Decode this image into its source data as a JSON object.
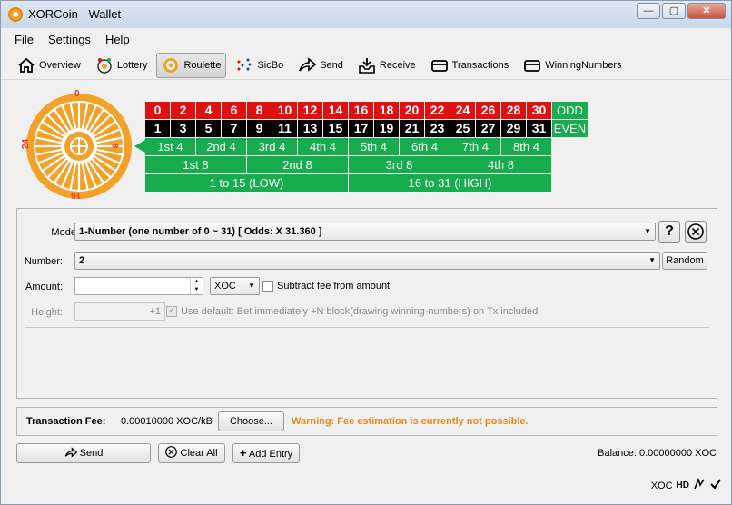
{
  "window": {
    "title": "XORCoin - Wallet",
    "minimize": "—",
    "maximize": "▢",
    "close": "✕"
  },
  "menu": {
    "file": "File",
    "settings": "Settings",
    "help": "Help"
  },
  "toolbar": {
    "overview": "Overview",
    "lottery": "Lottery",
    "roulette": "Roulette",
    "sicbo": "SicBo",
    "send": "Send",
    "receive": "Receive",
    "transactions": "Transactions",
    "winningnumbers": "WinningNumbers"
  },
  "wheel": {
    "top": "0",
    "right": "8",
    "bottom": "16",
    "left": "24"
  },
  "bet_table": {
    "even_row": [
      "0",
      "2",
      "4",
      "6",
      "8",
      "10",
      "12",
      "14",
      "16",
      "18",
      "20",
      "22",
      "24",
      "26",
      "28",
      "30"
    ],
    "odd_row": [
      "1",
      "3",
      "5",
      "7",
      "9",
      "11",
      "13",
      "15",
      "17",
      "19",
      "21",
      "23",
      "25",
      "27",
      "29",
      "31"
    ],
    "odd_label": "ODD",
    "even_label": "EVEN",
    "fourths": [
      "1st 4",
      "2nd 4",
      "3rd 4",
      "4th 4",
      "5th 4",
      "6th 4",
      "7th 4",
      "8th 4"
    ],
    "eighths": [
      "1st 8",
      "2nd 8",
      "3rd 8",
      "4th 8"
    ],
    "halves": [
      "1 to 15  (LOW)",
      "16 to 31 (HIGH)"
    ]
  },
  "form": {
    "mode_label": "Mode:",
    "mode_value": "1-Number    (one number of 0 ~ 31)   [ Odds: X 31.360 ]",
    "help_button": "?",
    "number_label": "Number:",
    "number_value": "2",
    "random_button": "Random",
    "amount_label": "Amount:",
    "amount_value": "",
    "unit_value": "XOC",
    "subtract_fee_label": "Subtract fee from amount",
    "height_label": "Height:",
    "height_value": "+1",
    "use_default_label": "Use default: Bet immediately +N block(drawing winning-numbers) on Tx included"
  },
  "fee": {
    "label": "Transaction Fee:",
    "value": "0.00010000 XOC/kB",
    "choose_button": "Choose...",
    "warning": "Warning: Fee estimation is currently not possible."
  },
  "actions": {
    "send": "Send",
    "clear_all": "Clear All",
    "add_entry": "Add Entry"
  },
  "balance": {
    "label": "Balance:",
    "value": "0.00000000 XOC"
  },
  "status": {
    "unit": "XOC",
    "hd": "HD"
  },
  "colors": {
    "red": "#e01010",
    "black": "#000000",
    "green": "#17ad4f",
    "wheel": "#f4a12a",
    "warning": "#e68a1e"
  }
}
